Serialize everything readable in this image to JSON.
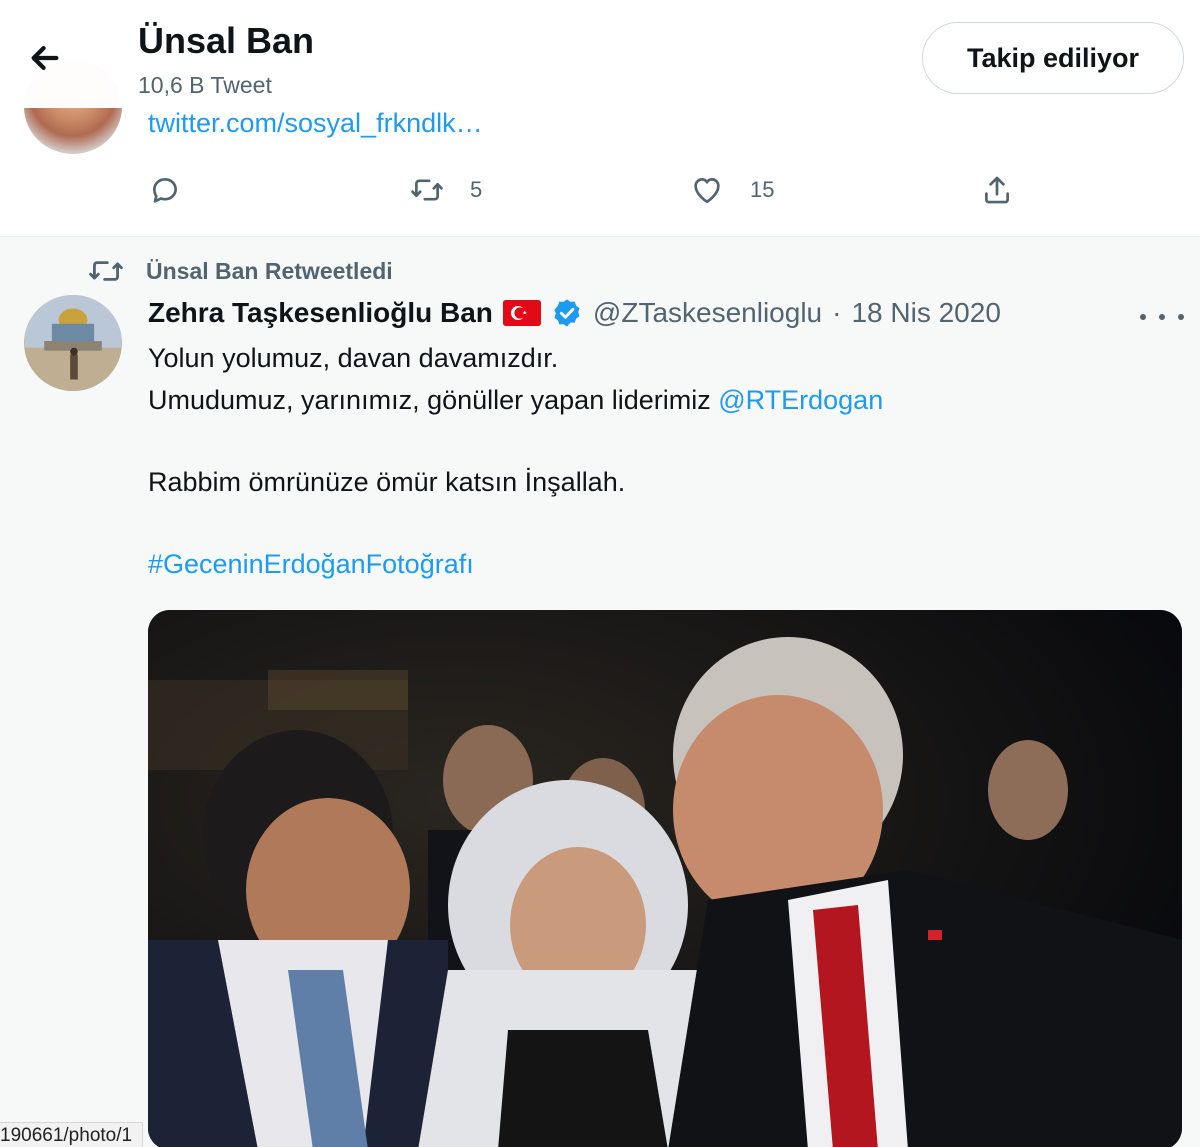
{
  "header": {
    "back_label": "Back",
    "name": "Ünsal Ban",
    "tweet_count": "10,6 B Tweet",
    "follow_button": "Takip ediliyor"
  },
  "previous_tweet": {
    "link_text": "twitter.com/sosyal_frkndlk…",
    "actions": {
      "reply_count": "",
      "retweet_count": "5",
      "like_count": "15"
    }
  },
  "tweet": {
    "retweeted_by": "Ünsal Ban Retweetledi",
    "author_name": "Zehra Taşkesenlioğlu Ban",
    "handle": "@ZTaskesenlioglu",
    "separator": "·",
    "date": "18 Nis 2020",
    "line1": "Yolun yolumuz, davan davamızdır.",
    "line2_text": "Umudumuz, yarınımız, gönüller yapan liderimiz ",
    "line2_mention": "@RTErdogan",
    "line3": "Rabbim ömrünüze ömür katsın İnşallah.",
    "hashtag": "#GeceninErdoğanFotoğrafı"
  },
  "status_bar": {
    "url_text": "190661/photo/1"
  },
  "colors": {
    "accent": "#1d9bf0",
    "secondary_text": "#536471",
    "tweet_background": "#f7f9f9",
    "flag_red": "#e30a17"
  },
  "icons": {
    "back": "arrow-left-icon",
    "reply": "reply-bubble-icon",
    "retweet": "retweet-icon",
    "like": "heart-icon",
    "share": "share-upload-icon",
    "verified": "verified-badge-icon",
    "flag": "turkish-flag-icon",
    "more": "more-dots-icon"
  }
}
